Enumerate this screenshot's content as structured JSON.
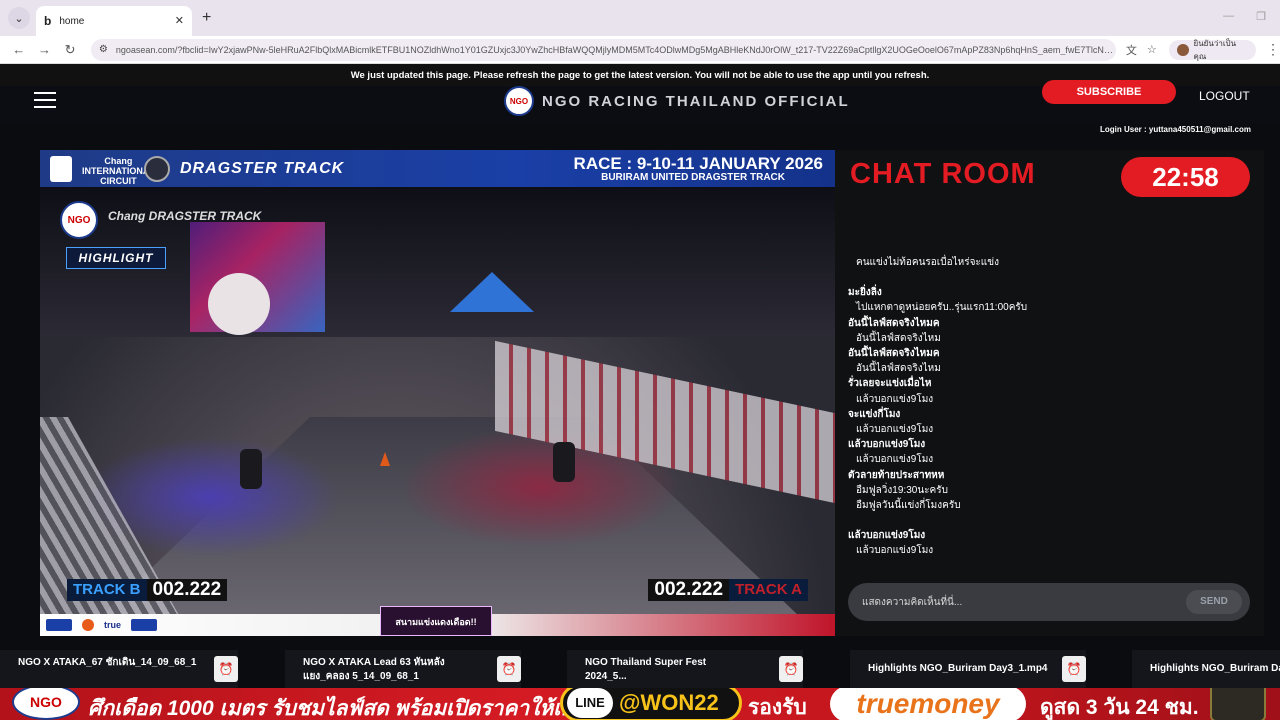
{
  "browser": {
    "tab_title": "home",
    "tab_favicon": "b",
    "url": "ngoasean.com/?fbclid=IwY2xjawPNw-5leHRuA2FlbQlxMABicmlkETFBU1NOZldhWno1Y01GZUxjc3J0YwZhcHBfaWQQMjlyMDM5MTc4ODlwMDg5MgABHleKNdJ0rOlW_t217-TV22Z69aCptllgX2UOGeOoelO67mApPZ83Np6hqHnS_aem_fwE7TlcNC...",
    "profile_label": "ยินยันว่าเป็นคุณ"
  },
  "notice": "We just updated this page. Please refresh the page to get the latest version. You will not be able to use the app until you refresh.",
  "header": {
    "brand": "NGO RACING THAILAND OFFICIAL",
    "logo_text": "NGO",
    "subscribe": "SUBSCRIBE",
    "logout": "LOGOUT",
    "login_user": "Login User : yuttana450511@gmail.com"
  },
  "video": {
    "sponsor": "Chang\nINTERNATIONAL\nCIRCUIT",
    "dragster": "DRAGSTER TRACK",
    "race_title": "RACE : 9-10-11 JANUARY 2026",
    "race_sub": "BURIRAM UNITED DRAGSTER TRACK",
    "highlight": "HIGHLIGHT",
    "watermark": "Chang DRAGSTER TRACK",
    "track_b_label": "TRACK B",
    "track_b_time": "002.222",
    "track_a_label": "TRACK A",
    "track_a_time": "002.222",
    "bottom_sponsor": "true",
    "promo": "สนามแข่งแดงเดือด!!"
  },
  "chat": {
    "title": "CHAT ROOM",
    "clock": "22:58",
    "messages": [
      {
        "user": "",
        "text": "คนแข่งไม่ท้อคนรอเบื่อไหร่จะแข่ง"
      },
      {
        "user": "มะยิ่งลิ่ง",
        "text": "ไปแหกตาดูหน่อยครับ..รุ่นแรก11:00ครับ"
      },
      {
        "user": "อันนี้ไลฟ์สดจริงไหมค",
        "text": "อันนี้ไลฟ์สดจริงไหม"
      },
      {
        "user": "อันนี้ไลฟ์สดจริงไหมค",
        "text": "อันนี้ไลฟ์สดจริงไหม"
      },
      {
        "user": "รั่วเลยจะแข่งเมื่อไห",
        "text": "แล้วบอกแข่ง9โมง"
      },
      {
        "user": "จะแข่งกี่โมง",
        "text": "แล้วบอกแข่ง9โมง"
      },
      {
        "user": "แล้วบอกแข่ง9โมง",
        "text": "แล้วบอกแข่ง9โมง"
      },
      {
        "user": "ตัวลายท้ายประสาทหห",
        "text": "อืมฟูลวิ่ง19:30นะครับ"
      },
      {
        "user": "",
        "text": "อืมฟูลวันนี้แข่งกี่โมงครับ"
      },
      {
        "user": "แล้วบอกแข่ง9โมง",
        "text": "แล้วบอกแข่ง9โมง"
      }
    ],
    "input_placeholder": "แสดงความคิดเห็นที่นี่...",
    "send": "SEND"
  },
  "strip": [
    {
      "line1": "NGO X ATAKA_67 ชักเดิน_14_09_68_1",
      "line2": ""
    },
    {
      "line1": "NGO X ATAKA Lead 63 หันหลัง",
      "line2": "แยง_คลอง 5_14_09_68_1"
    },
    {
      "line1": "NGO Thailand Super Fest",
      "line2": "2024_5..."
    },
    {
      "line1": "Highlights NGO_Buriram Day3_1.mp4",
      "line2": ""
    },
    {
      "line1": "Highlights NGO_Buriram Da",
      "line2": ""
    }
  ],
  "ad": {
    "logo": "NGO",
    "text": "ศึกเดือด 1000 เมตร รับชมไลฟ์สด พร้อมเปิดราคาให้เดิมพัน",
    "line_label": "LINE",
    "line_id": "@WON22",
    "accept": "รองรับ",
    "truemoney": "truemoney",
    "deal": "ดูสด 3 วัน 24 ชม."
  },
  "icons": {
    "tab_menu": "chevron-down-icon",
    "close": "close-icon",
    "new_tab": "plus-icon",
    "back": "back-arrow-icon",
    "forward": "forward-arrow-icon",
    "reload": "reload-icon",
    "site_info": "tune-icon",
    "translate": "translate-icon",
    "bookmark": "star-icon",
    "menu": "kebab-icon",
    "hamburger": "hamburger-icon",
    "alarm": "alarm-icon"
  },
  "colors": {
    "accent_red": "#e31b23",
    "brand_blue": "#1a3fa6",
    "track_b": "#3aa0ff",
    "line_gold": "#f7c21a"
  }
}
